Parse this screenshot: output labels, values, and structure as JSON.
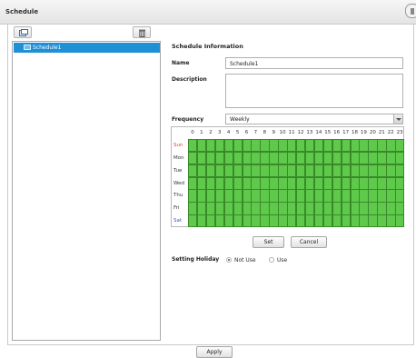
{
  "window": {
    "title": "Schedule"
  },
  "toolbar": {
    "add_icon": "add-schedule-icon",
    "delete_icon": "trash-icon"
  },
  "schedule_list": {
    "items": [
      "Schedule1"
    ],
    "selected": "Schedule1"
  },
  "form": {
    "section_title": "Schedule Information",
    "name_label": "Name",
    "name_value": "Schedule1",
    "description_label": "Description",
    "description_value": "",
    "frequency_label": "Frequency",
    "frequency_value": "Weekly"
  },
  "grid": {
    "hours": [
      "0",
      "1",
      "2",
      "3",
      "4",
      "5",
      "6",
      "7",
      "8",
      "9",
      "10",
      "11",
      "12",
      "13",
      "14",
      "15",
      "16",
      "17",
      "18",
      "19",
      "20",
      "21",
      "22",
      "23"
    ],
    "days": [
      "Sun",
      "Mon",
      "Tue",
      "Wed",
      "Thu",
      "Fri",
      "Sat"
    ],
    "day_colors": {
      "Sun": "#e23b3b",
      "Sat": "#3b4fe2"
    },
    "all_selected": true,
    "selected_color": "#5ec94a"
  },
  "buttons": {
    "set": "Set",
    "cancel": "Cancel",
    "apply": "Apply"
  },
  "holiday": {
    "label": "Setting Holiday",
    "options": [
      "Not Use",
      "Use"
    ],
    "selected": "Not Use"
  }
}
